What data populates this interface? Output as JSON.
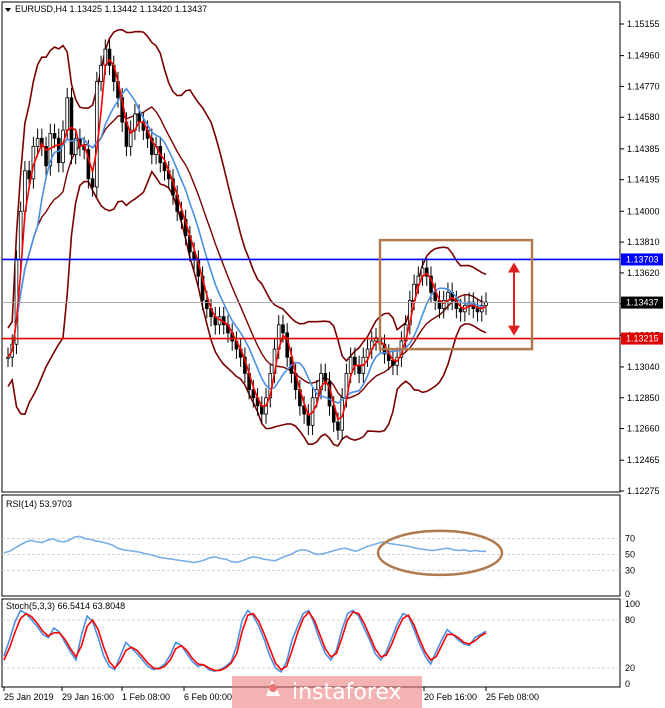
{
  "chart_data": {
    "type": "candlestick",
    "main": {
      "title": "EURUSD,H4  1.13425 1.13442 1.13420 1.13437",
      "price_ticks": [
        "1.15155",
        "1.14960",
        "1.14770",
        "1.14580",
        "1.14385",
        "1.14195",
        "1.14000",
        "1.13810",
        "1.13620",
        "1.13430",
        "1.13235",
        "1.13040",
        "1.12850",
        "1.12660",
        "1.12465",
        "1.12275"
      ],
      "ylim": [
        1.12275,
        1.15155
      ],
      "horizontal_levels": [
        {
          "price": 1.13703,
          "label": "1.13703",
          "color": "#0000ff"
        },
        {
          "price": 1.13215,
          "label": "1.13215",
          "color": "#e00000"
        }
      ],
      "current_price": {
        "price": 1.13437,
        "label": "1.13437"
      },
      "close_path": [
        1.131,
        1.1318,
        1.137,
        1.14,
        1.1425,
        1.142,
        1.144,
        1.1445,
        1.144,
        1.1428,
        1.1448,
        1.1445,
        1.143,
        1.145,
        1.147,
        1.1435,
        1.1445,
        1.144,
        1.1438,
        1.142,
        1.1415,
        1.148,
        1.149,
        1.15,
        1.149,
        1.148,
        1.147,
        1.1455,
        1.144,
        1.145,
        1.146,
        1.1455,
        1.145,
        1.1445,
        1.1435,
        1.144,
        1.143,
        1.1425,
        1.142,
        1.141,
        1.14,
        1.1395,
        1.1385,
        1.1375,
        1.137,
        1.136,
        1.1345,
        1.134,
        1.1335,
        1.133,
        1.1335,
        1.133,
        1.1325,
        1.132,
        1.1315,
        1.131,
        1.13,
        1.129,
        1.1285,
        1.128,
        1.1275,
        1.1285,
        1.13,
        1.1315,
        1.133,
        1.1325,
        1.131,
        1.13,
        1.129,
        1.128,
        1.1275,
        1.1268,
        1.1285,
        1.129,
        1.13,
        1.1295,
        1.128,
        1.127,
        1.1265,
        1.1285,
        1.13,
        1.131,
        1.1305,
        1.13,
        1.131,
        1.1315,
        1.132,
        1.1322,
        1.1318,
        1.1312,
        1.1308,
        1.1305,
        1.131,
        1.132,
        1.133,
        1.1345,
        1.1355,
        1.136,
        1.1365,
        1.136,
        1.135,
        1.1345,
        1.134,
        1.1345,
        1.135,
        1.1345,
        1.134,
        1.1338,
        1.1342,
        1.1344,
        1.134,
        1.1338,
        1.1342,
        1.1344
      ],
      "indicators": [
        "Bollinger Bands",
        "MA fast",
        "MA slow"
      ],
      "annotations": [
        "range-box",
        "range-arrow"
      ]
    },
    "rsi": {
      "label": "RSI(14) 53.9703",
      "levels": [
        "70",
        "50",
        "30",
        "0"
      ],
      "ylim": [
        0,
        100
      ],
      "values": [
        52,
        54,
        58,
        62,
        66,
        68,
        66,
        65,
        68,
        70,
        67,
        66,
        68,
        72,
        73,
        70,
        69,
        67,
        66,
        64,
        62,
        58,
        56,
        55,
        54,
        53,
        51,
        50,
        48,
        46,
        45,
        44,
        43,
        42,
        41,
        40,
        41,
        43,
        46,
        47,
        45,
        44,
        41,
        40,
        42,
        45,
        47,
        46,
        44,
        43,
        42,
        45,
        48,
        50,
        54,
        56,
        55,
        52,
        50,
        51,
        53,
        55,
        57,
        58,
        56,
        54,
        57,
        60,
        62,
        64,
        66,
        64,
        63,
        62,
        61,
        60,
        58,
        57,
        56,
        55,
        56,
        57,
        58,
        56,
        55,
        56,
        54,
        55,
        54,
        54
      ]
    },
    "stoch": {
      "label": "Stoch(5,3,3) 66.5414 63.8048",
      "levels": [
        "100",
        "80",
        "20",
        "0"
      ],
      "ylim": [
        0,
        100
      ],
      "main_values": [
        35,
        55,
        78,
        92,
        88,
        80,
        72,
        62,
        58,
        70,
        65,
        52,
        40,
        30,
        62,
        85,
        78,
        58,
        35,
        22,
        18,
        35,
        52,
        45,
        38,
        30,
        22,
        18,
        20,
        25,
        36,
        52,
        48,
        38,
        28,
        22,
        24,
        18,
        16,
        18,
        22,
        28,
        48,
        80,
        92,
        85,
        72,
        55,
        35,
        20,
        15,
        28,
        55,
        72,
        88,
        92,
        75,
        55,
        38,
        30,
        42,
        68,
        88,
        92,
        85,
        70,
        55,
        38,
        30,
        40,
        58,
        75,
        88,
        85,
        68,
        50,
        35,
        25,
        40,
        55,
        68,
        62,
        55,
        50,
        48,
        58,
        62,
        66
      ],
      "signal_values": [
        30,
        45,
        65,
        82,
        88,
        84,
        76,
        66,
        60,
        64,
        64,
        56,
        44,
        34,
        48,
        72,
        80,
        68,
        46,
        28,
        20,
        28,
        42,
        46,
        42,
        34,
        26,
        20,
        19,
        22,
        30,
        44,
        48,
        42,
        32,
        25,
        24,
        20,
        17,
        17,
        20,
        26,
        38,
        66,
        86,
        88,
        78,
        62,
        44,
        26,
        18,
        22,
        42,
        64,
        82,
        90,
        80,
        62,
        44,
        34,
        38,
        58,
        80,
        90,
        88,
        76,
        60,
        44,
        34,
        36,
        50,
        68,
        82,
        86,
        74,
        56,
        40,
        30,
        34,
        48,
        62,
        62,
        58,
        52,
        50,
        54,
        60,
        64
      ]
    },
    "x_labels": [
      "25 Jan 2019",
      "29 Jan 16:00",
      "1 Feb 08:00",
      "6 Feb 00:00",
      "20 Feb 16:00",
      "25 Feb 08:00"
    ],
    "watermark": "instaforex",
    "colors": {
      "bands": "#7a0000",
      "ma_fast": "#ff0000",
      "ma_slow": "#4a90e2",
      "candle": "#000000",
      "box": "#b07a50",
      "arrow": "#e02020",
      "rsi": "#7aaee8",
      "grid": "#c8c8c8"
    }
  }
}
